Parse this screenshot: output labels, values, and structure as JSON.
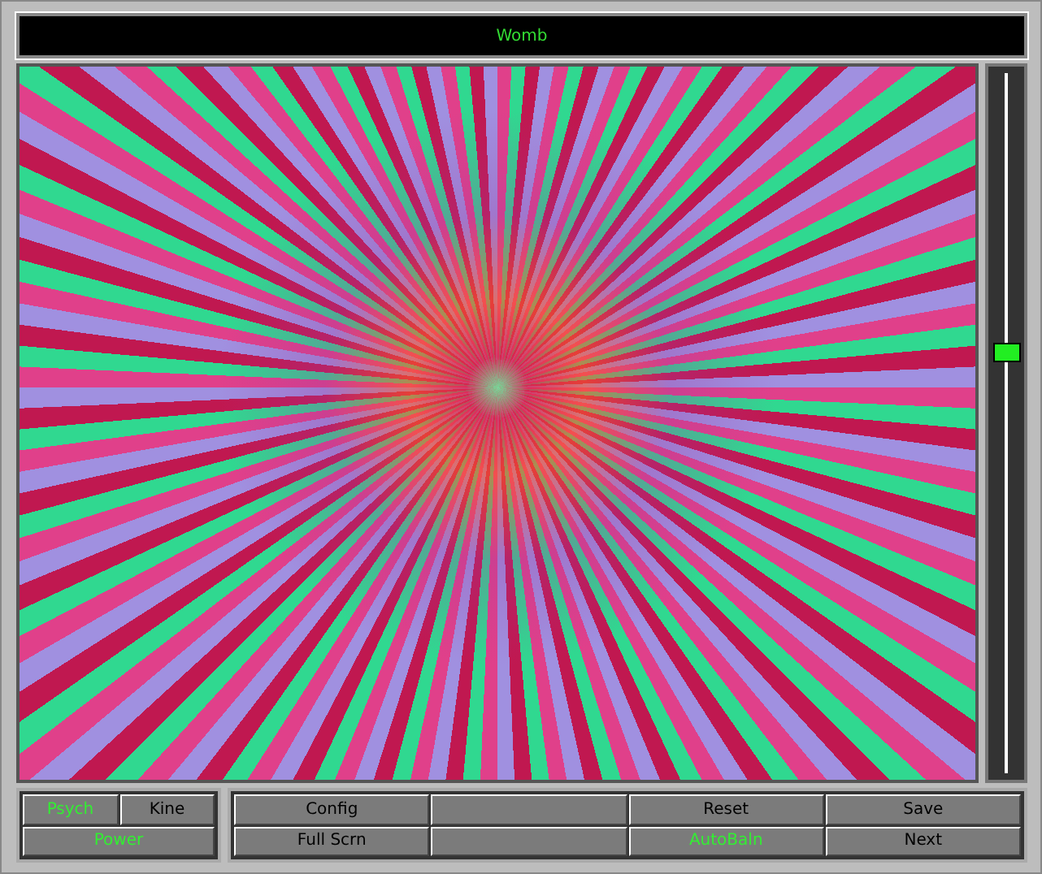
{
  "title": "Womb",
  "slider": {
    "level": 0.6
  },
  "mode_buttons": [
    {
      "kind": "label",
      "label": "Psych",
      "active": true
    },
    {
      "kind": "label",
      "label": "Kine",
      "active": false
    },
    {
      "kind": "label",
      "label": "Power",
      "active": true
    }
  ],
  "control_buttons": [
    {
      "kind": "label",
      "label": "Config",
      "active": false
    },
    {
      "kind": "blank"
    },
    {
      "kind": "label",
      "label": "Reset",
      "active": false
    },
    {
      "kind": "label",
      "label": "Save",
      "active": false
    },
    {
      "kind": "label",
      "label": "Full Scrn",
      "active": false
    },
    {
      "kind": "blank"
    },
    {
      "kind": "label",
      "label": "AutoBaln",
      "active": true
    },
    {
      "kind": "label",
      "label": "Next",
      "active": false
    }
  ]
}
